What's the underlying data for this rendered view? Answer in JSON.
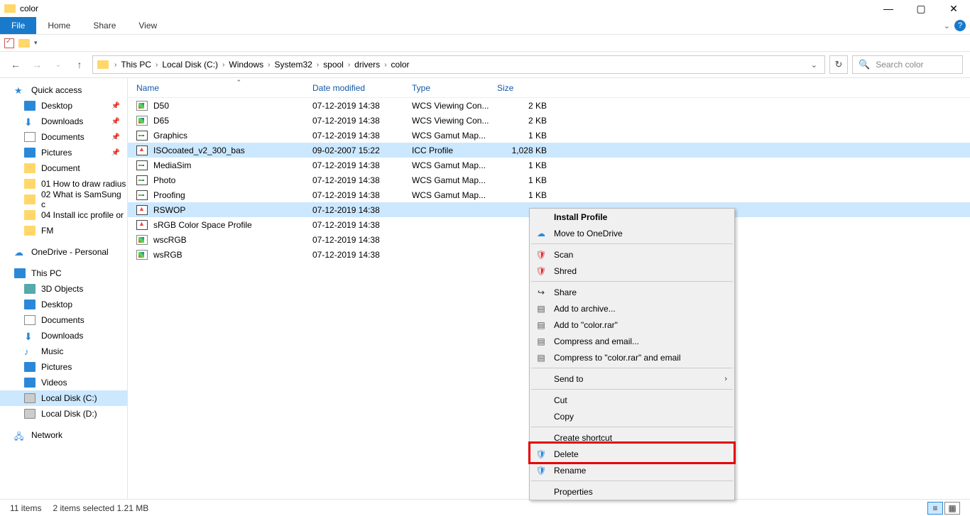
{
  "title": "color",
  "ribbon": {
    "file": "File",
    "home": "Home",
    "share": "Share",
    "view": "View"
  },
  "nav": {
    "crumbs": [
      "This PC",
      "Local Disk (C:)",
      "Windows",
      "System32",
      "spool",
      "drivers",
      "color"
    ],
    "search_placeholder": "Search color"
  },
  "sidebar": {
    "quick": "Quick access",
    "quick_items": [
      {
        "label": "Desktop",
        "icon": "desk",
        "pinned": true
      },
      {
        "label": "Downloads",
        "icon": "down",
        "pinned": true
      },
      {
        "label": "Documents",
        "icon": "doc",
        "pinned": true
      },
      {
        "label": "Pictures",
        "icon": "pic",
        "pinned": true
      },
      {
        "label": "Document",
        "icon": "fold"
      },
      {
        "label": "01 How to draw radius",
        "icon": "fold"
      },
      {
        "label": "02 What is SamSung c",
        "icon": "fold"
      },
      {
        "label": "04 Install icc profile or",
        "icon": "fold"
      },
      {
        "label": "FM",
        "icon": "fold"
      }
    ],
    "onedrive": "OneDrive - Personal",
    "thispc": "This PC",
    "pc_items": [
      {
        "label": "3D Objects",
        "icon": "3d"
      },
      {
        "label": "Desktop",
        "icon": "desk"
      },
      {
        "label": "Documents",
        "icon": "doc"
      },
      {
        "label": "Downloads",
        "icon": "down"
      },
      {
        "label": "Music",
        "icon": "mus"
      },
      {
        "label": "Pictures",
        "icon": "pic"
      },
      {
        "label": "Videos",
        "icon": "vid"
      },
      {
        "label": "Local Disk (C:)",
        "icon": "disk",
        "selected": true
      },
      {
        "label": "Local Disk (D:)",
        "icon": "disk"
      }
    ],
    "network": "Network"
  },
  "columns": {
    "name": "Name",
    "date": "Date modified",
    "type": "Type",
    "size": "Size"
  },
  "files": [
    {
      "name": "D50",
      "date": "07-12-2019 14:38",
      "type": "WCS Viewing Con...",
      "size": "2 KB",
      "fic": "wcs"
    },
    {
      "name": "D65",
      "date": "07-12-2019 14:38",
      "type": "WCS Viewing Con...",
      "size": "2 KB",
      "fic": "wcs"
    },
    {
      "name": "Graphics",
      "date": "07-12-2019 14:38",
      "type": "WCS Gamut Map...",
      "size": "1 KB",
      "fic": "gmp"
    },
    {
      "name": "ISOcoated_v2_300_bas",
      "date": "09-02-2007 15:22",
      "type": "ICC Profile",
      "size": "1,028 KB",
      "fic": "icc",
      "selected": true
    },
    {
      "name": "MediaSim",
      "date": "07-12-2019 14:38",
      "type": "WCS Gamut Map...",
      "size": "1 KB",
      "fic": "gmp"
    },
    {
      "name": "Photo",
      "date": "07-12-2019 14:38",
      "type": "WCS Gamut Map...",
      "size": "1 KB",
      "fic": "gmp"
    },
    {
      "name": "Proofing",
      "date": "07-12-2019 14:38",
      "type": "WCS Gamut Map...",
      "size": "1 KB",
      "fic": "gmp"
    },
    {
      "name": "RSWOP",
      "date": "07-12-2019 14:38",
      "type": "",
      "size": "",
      "fic": "icc",
      "selected": true
    },
    {
      "name": "sRGB Color Space Profile",
      "date": "07-12-2019 14:38",
      "type": "",
      "size": "",
      "fic": "icc"
    },
    {
      "name": "wscRGB",
      "date": "07-12-2019 14:38",
      "type": "",
      "size": "",
      "fic": "wcs"
    },
    {
      "name": "wsRGB",
      "date": "07-12-2019 14:38",
      "type": "",
      "size": "",
      "fic": "wcs"
    }
  ],
  "ctx": {
    "install": "Install Profile",
    "onedrive": "Move to OneDrive",
    "scan": "Scan",
    "shred": "Shred",
    "share": "Share",
    "addarch": "Add to archive...",
    "addrar": "Add to \"color.rar\"",
    "compemail": "Compress and email...",
    "comprar": "Compress to \"color.rar\" and email",
    "sendto": "Send to",
    "cut": "Cut",
    "copy": "Copy",
    "shortcut": "Create shortcut",
    "delete": "Delete",
    "rename": "Rename",
    "properties": "Properties"
  },
  "status": {
    "count": "11 items",
    "sel": "2 items selected  1.21 MB"
  }
}
